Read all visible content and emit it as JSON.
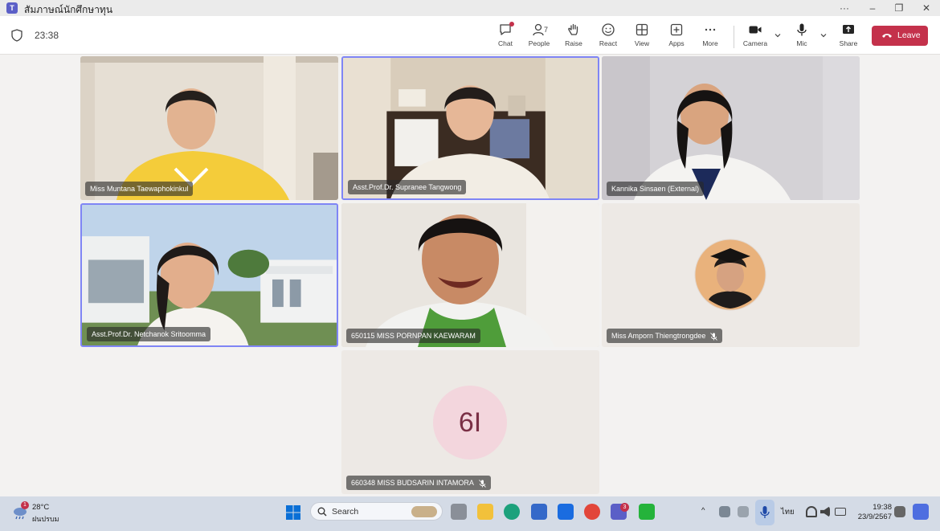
{
  "window": {
    "title": "สัมภาษณ์นักศึกษาทุน"
  },
  "toolbar": {
    "timer": "23:38",
    "people_count": "7",
    "buttons": [
      {
        "label": "Chat",
        "icon": "chat-icon"
      },
      {
        "label": "People",
        "icon": "people-icon"
      },
      {
        "label": "Raise",
        "icon": "hand-icon"
      },
      {
        "label": "React",
        "icon": "smiley-icon"
      },
      {
        "label": "View",
        "icon": "grid-icon"
      },
      {
        "label": "Apps",
        "icon": "plus-box-icon"
      },
      {
        "label": "More",
        "icon": "ellipsis-icon"
      },
      {
        "label": "Camera",
        "icon": "camera-icon"
      },
      {
        "label": "Mic",
        "icon": "mic-icon"
      },
      {
        "label": "Share",
        "icon": "share-icon"
      }
    ],
    "leave_label": "Leave",
    "leave_color": "#c4314b"
  },
  "participants": [
    {
      "name": "Miss Muntana Taewaphokinkul",
      "muted": false,
      "active": false
    },
    {
      "name": "Asst.Prof.Dr. Supranee Tangwong",
      "muted": false,
      "active": true
    },
    {
      "name": "Kannika Sinsaen (External)",
      "muted": false,
      "active": false
    },
    {
      "name": "Asst.Prof.Dr. Netchanok Sritoomma",
      "muted": false,
      "active": true
    },
    {
      "name": "650115 MISS PORNPAN KAEWARAM",
      "muted": false,
      "active": false
    },
    {
      "name": "Miss Amporn Thiengtrongdee",
      "muted": true,
      "active": false
    },
    {
      "name": "660348 MISS BUDSARIN INTAMORA",
      "muted": true,
      "active": false,
      "initials": "6I"
    }
  ],
  "taskbar": {
    "weather_temp": "28°C",
    "weather_desc": "ฝนปรบม",
    "weather_badge": "1",
    "search_label": "Search",
    "teams_badge": "3",
    "language": "ไทย",
    "time": "19:38",
    "date": "23/9/2567"
  },
  "colors": {
    "accent": "#5b5fc7",
    "active_border": "#7f85f5",
    "leave": "#c4314b"
  }
}
